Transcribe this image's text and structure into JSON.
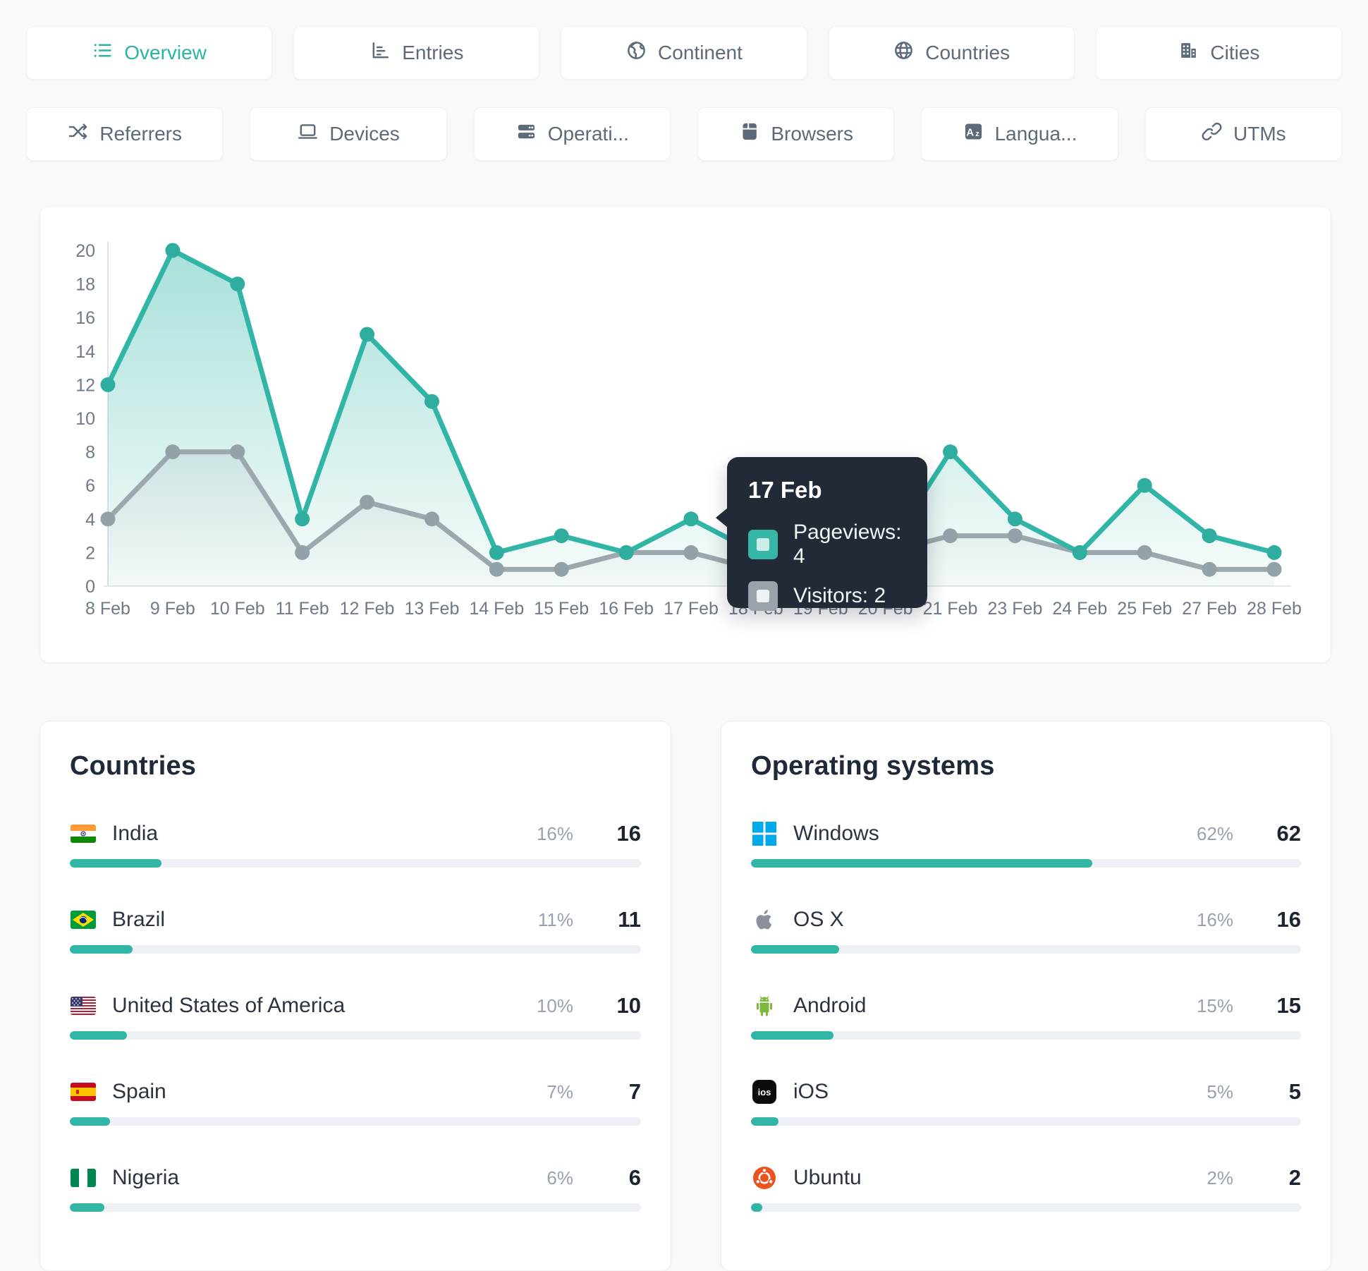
{
  "accent": "#31b5a6",
  "gray_series_color": "#9ba8ae",
  "page_bg": "#f7f9fb",
  "tabs_row1": [
    {
      "label": "Overview",
      "icon": "list-icon",
      "active": true
    },
    {
      "label": "Entries",
      "icon": "bar-chart-icon",
      "active": false
    },
    {
      "label": "Continent",
      "icon": "globe-continent-icon",
      "active": false
    },
    {
      "label": "Countries",
      "icon": "globe-icon",
      "active": false
    },
    {
      "label": "Cities",
      "icon": "buildings-icon",
      "active": false
    }
  ],
  "tabs_row2": [
    {
      "label": "Referrers",
      "icon": "shuffle-icon",
      "active": false
    },
    {
      "label": "Devices",
      "icon": "laptop-icon",
      "active": false
    },
    {
      "label": "Operati...",
      "icon": "server-icon",
      "active": false
    },
    {
      "label": "Browsers",
      "icon": "browser-icon",
      "active": false
    },
    {
      "label": "Langua...",
      "icon": "language-icon",
      "active": false
    },
    {
      "label": "UTMs",
      "icon": "link-icon",
      "active": false
    }
  ],
  "chart_data": {
    "type": "line",
    "x": [
      "8 Feb",
      "9 Feb",
      "10 Feb",
      "11 Feb",
      "12 Feb",
      "13 Feb",
      "14 Feb",
      "15 Feb",
      "16 Feb",
      "17 Feb",
      "18 Feb",
      "19 Feb",
      "20 Feb",
      "21 Feb",
      "23 Feb",
      "24 Feb",
      "25 Feb",
      "27 Feb",
      "28 Feb"
    ],
    "series": [
      {
        "name": "Pageviews",
        "color": "#31b5a6",
        "values": [
          12,
          20,
          18,
          4,
          15,
          11,
          2,
          3,
          2,
          4,
          2,
          1,
          2,
          8,
          4,
          2,
          6,
          3,
          2
        ]
      },
      {
        "name": "Visitors",
        "color": "#9ba8ae",
        "values": [
          4,
          8,
          8,
          2,
          5,
          4,
          1,
          1,
          2,
          2,
          1,
          1,
          2,
          3,
          3,
          2,
          2,
          1,
          1
        ]
      }
    ],
    "ylim": [
      0,
      20
    ],
    "yticks": [
      0,
      2,
      4,
      6,
      8,
      10,
      12,
      14,
      16,
      18,
      20
    ],
    "grid": "none",
    "legend": "none",
    "tooltip": {
      "date": "17 Feb",
      "point_index": 9,
      "rows": [
        {
          "label": "Pageviews: 4",
          "chip_outer": "#35b6a7",
          "chip_inner": "#cdebe7"
        },
        {
          "label": "Visitors: 2",
          "chip_outer": "#98a2aa",
          "chip_inner": "#eef1f3"
        }
      ]
    }
  },
  "countries_panel": {
    "title": "Countries",
    "rows": [
      {
        "flag": "in",
        "name": "India",
        "pct_label": "16%",
        "pct": 16,
        "count": "16"
      },
      {
        "flag": "br",
        "name": "Brazil",
        "pct_label": "11%",
        "pct": 11,
        "count": "11"
      },
      {
        "flag": "us",
        "name": "United States of America",
        "pct_label": "10%",
        "pct": 10,
        "count": "10"
      },
      {
        "flag": "es",
        "name": "Spain",
        "pct_label": "7%",
        "pct": 7,
        "count": "7"
      },
      {
        "flag": "ng",
        "name": "Nigeria",
        "pct_label": "6%",
        "pct": 6,
        "count": "6"
      }
    ]
  },
  "os_panel": {
    "title": "Operating systems",
    "rows": [
      {
        "os": "windows",
        "name": "Windows",
        "pct_label": "62%",
        "pct": 62,
        "count": "62"
      },
      {
        "os": "osx",
        "name": "OS X",
        "pct_label": "16%",
        "pct": 16,
        "count": "16"
      },
      {
        "os": "android",
        "name": "Android",
        "pct_label": "15%",
        "pct": 15,
        "count": "15"
      },
      {
        "os": "ios",
        "name": "iOS",
        "pct_label": "5%",
        "pct": 5,
        "count": "5"
      },
      {
        "os": "ubuntu",
        "name": "Ubuntu",
        "pct_label": "2%",
        "pct": 2,
        "count": "2"
      }
    ]
  }
}
